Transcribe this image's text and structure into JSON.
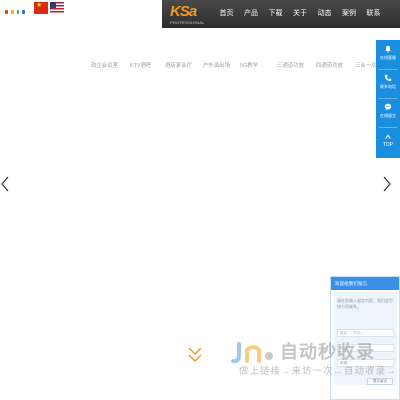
{
  "header": {
    "logo_text": "KSa",
    "logo_sub": "PROFESSIONAL",
    "flags": [
      "china-flag-icon",
      "us-flag-icon"
    ],
    "accent": "#f39a1e",
    "nav_bg": "#353535",
    "nav": [
      {
        "label": "首页"
      },
      {
        "label": "产品"
      },
      {
        "label": "下载"
      },
      {
        "label": "关于"
      },
      {
        "label": "动态"
      },
      {
        "label": "案例"
      },
      {
        "label": "联系"
      }
    ]
  },
  "subnav": {
    "items": [
      {
        "label": "政企会议室"
      },
      {
        "label": "KTV酒吧"
      },
      {
        "label": "酒店宴会厅"
      },
      {
        "label": "户外演出场"
      },
      {
        "label": "5G教学"
      },
      {
        "label": "三通道功放"
      },
      {
        "label": "四通道功放"
      },
      {
        "label": "三合一功..."
      }
    ]
  },
  "slider": {
    "prev_icon": "chevron-left-icon",
    "next_icon": "chevron-right-icon"
  },
  "sidebar": {
    "bg": "#1a8fe0",
    "items": [
      {
        "label": "在线客服",
        "icon": "bell-icon"
      },
      {
        "label": "联系电话",
        "icon": "phone-icon"
      },
      {
        "label": "在线留言",
        "icon": "chat-icon"
      },
      {
        "label": "TOP",
        "icon": "arrow-up-icon"
      }
    ]
  },
  "message_panel": {
    "title": "欢迎给我们留言",
    "intro": "请在此输入留言内容，我们会尽快与您联系。",
    "fields": [
      {
        "label": "姓名",
        "placeholder": "/ 请输入..."
      },
      {
        "label": "电话",
        "placeholder": ""
      },
      {
        "label": "邮箱",
        "placeholder": ""
      }
    ],
    "submit_label": "提交留言",
    "header_color": "#3a90e6"
  },
  "watermark": {
    "title": "自动秒收录",
    "subtitle": "做上链接→来访一次→自动收录→"
  }
}
